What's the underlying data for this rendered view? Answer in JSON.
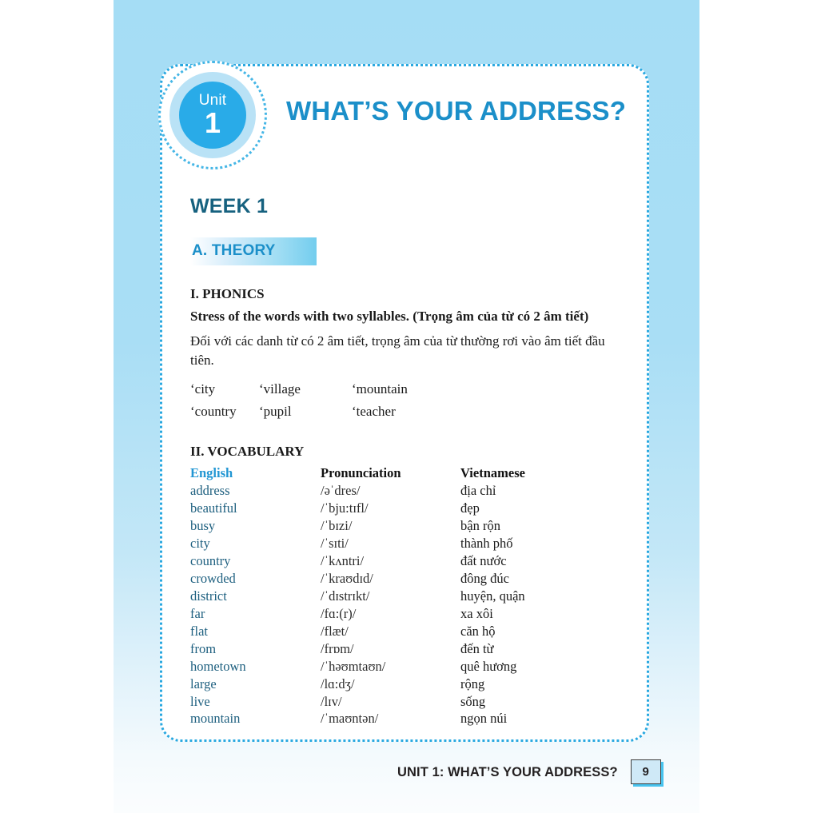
{
  "unit_badge": {
    "unit_word": "Unit",
    "unit_number": "1"
  },
  "header": {
    "title": "WHAT’S YOUR ADDRESS?"
  },
  "week": {
    "heading": "WEEK 1"
  },
  "theory": {
    "label": "A. THEORY"
  },
  "phonics": {
    "heading": "I. PHONICS",
    "rule": "Stress of the words with two syllables. (Trọng âm của từ có 2 âm tiết)",
    "description": "Đối với các danh từ có 2 âm tiết, trọng âm của từ thường rơi vào âm tiết đầu tiên.",
    "examples": [
      [
        "‘city",
        "‘village",
        "‘mountain"
      ],
      [
        "‘country",
        "‘pupil",
        "‘teacher"
      ]
    ]
  },
  "vocabulary": {
    "heading": "II. VOCABULARY",
    "columns": [
      "English",
      "Pronunciation",
      "Vietnamese"
    ],
    "rows": [
      {
        "english": "address",
        "pronunciation": "/əˈdres/",
        "vietnamese": "địa chỉ"
      },
      {
        "english": "beautiful",
        "pronunciation": "/ˈbju:tɪfl/",
        "vietnamese": "đẹp"
      },
      {
        "english": "busy",
        "pronunciation": "/ˈbɪzi/",
        "vietnamese": "bận rộn"
      },
      {
        "english": "city",
        "pronunciation": "/ˈsɪti/",
        "vietnamese": "thành phố"
      },
      {
        "english": "country",
        "pronunciation": "/ˈkʌntri/",
        "vietnamese": "đất nước"
      },
      {
        "english": "crowded",
        "pronunciation": "/ˈkraʊdɪd/",
        "vietnamese": "đông đúc"
      },
      {
        "english": "district",
        "pronunciation": "/ˈdɪstrɪkt/",
        "vietnamese": "huyện, quận"
      },
      {
        "english": "far",
        "pronunciation": "/fɑ:(r)/",
        "vietnamese": "xa xôi"
      },
      {
        "english": "flat",
        "pronunciation": "/flæt/",
        "vietnamese": "căn hộ"
      },
      {
        "english": "from",
        "pronunciation": "/frɒm/",
        "vietnamese": "đến từ"
      },
      {
        "english": "hometown",
        "pronunciation": "/ˈhəʊmtaʊn/",
        "vietnamese": "quê hương"
      },
      {
        "english": "large",
        "pronunciation": "/lɑ:dʒ/",
        "vietnamese": "rộng"
      },
      {
        "english": "live",
        "pronunciation": "/lɪv/",
        "vietnamese": "sống"
      },
      {
        "english": "mountain",
        "pronunciation": "/ˈmaʊntən/",
        "vietnamese": "ngọn núi"
      }
    ]
  },
  "footer": {
    "title": "UNIT 1: WHAT’S YOUR ADDRESS?",
    "page_number": "9"
  },
  "colors": {
    "page_blue": "#a5ddf5",
    "accent_blue": "#29abe8",
    "title_blue": "#1b8fc9",
    "heading_teal": "#16617f",
    "word_blue": "#1d5f7f",
    "header_blue": "#2196d3",
    "dotted_border": "#29a8e0",
    "page_box_fill": "#cfe9f7",
    "page_box_shadow": "#48c3ee"
  }
}
